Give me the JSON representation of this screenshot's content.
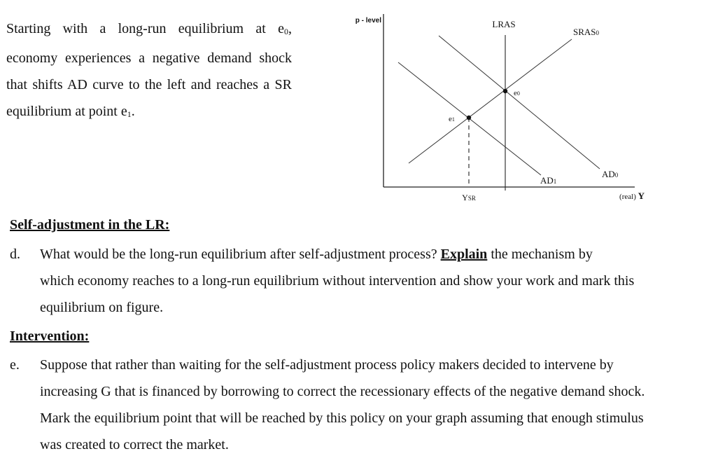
{
  "intro": {
    "text_before_e0": "Starting with a long-run equilibrium at e",
    "e0_sub": "0",
    "text_after_e0": ", economy experiences a negative demand shock that shifts AD curve to the left and reaches a SR equilibrium at point e",
    "e1_sub": "1",
    "text_end": "."
  },
  "diagram": {
    "y_axis_label": "p - level",
    "x_axis_label_prefix": "(real) ",
    "x_axis_label_var": "Y",
    "curves": {
      "lras": "LRAS",
      "sras0_main": "SRAS",
      "sras0_sub": "0",
      "ad0_main": "AD",
      "ad0_sub": "0",
      "ad1_main": "AD",
      "ad1_sub": "1"
    },
    "points": {
      "e0_main": "e",
      "e0_sub": "0",
      "e1_main": "e",
      "e1_sub": "1"
    },
    "ysr_main": "Y",
    "ysr_sub": "SR"
  },
  "section_self": {
    "heading": "Self-adjustment in the LR:",
    "letter": "d.",
    "text_1": "What would be the long-run equilibrium after self-adjustment process? ",
    "emph": "Explain",
    "text_2": " the mechanism by",
    "line_2": "which economy reaches to a long-run equilibrium without intervention and show your work and mark this",
    "line_3": "equilibrium on figure."
  },
  "section_intervention": {
    "heading": "Intervention:",
    "letter": "e.",
    "line_1": "Suppose that rather than waiting for the self-adjustment process policy makers decided to intervene by",
    "line_2": "increasing G that is financed by borrowing to correct the recessionary effects of the negative demand shock.",
    "line_3": "Mark the equilibrium point that will be reached by this policy on your graph assuming that enough stimulus",
    "line_4": "was created to correct the market."
  }
}
